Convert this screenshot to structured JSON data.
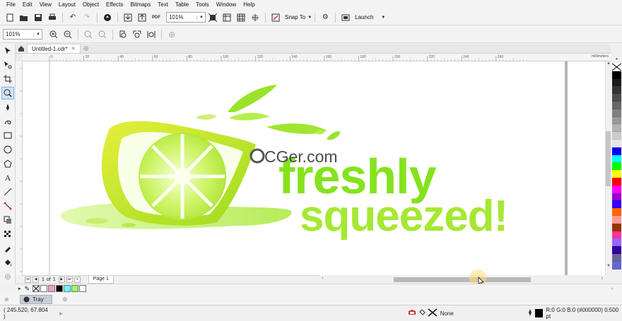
{
  "menu": [
    "File",
    "Edit",
    "View",
    "Layout",
    "Object",
    "Effects",
    "Bitmaps",
    "Text",
    "Table",
    "Tools",
    "Window",
    "Help"
  ],
  "toolbar1": {
    "zoom_value": "101%",
    "snap_label": "Snap To",
    "launch_label": "Launch"
  },
  "toolbar2": {
    "zoom_value": "101%"
  },
  "document": {
    "tab_title": "Untitled-1.cdr*"
  },
  "ruler": {
    "unit_label": "millimeters",
    "h_ticks": [
      "0",
      "20",
      "40",
      "60",
      "80",
      "100",
      "120",
      "140",
      "160",
      "180",
      "200",
      "220",
      "240",
      "260"
    ]
  },
  "artwork": {
    "line1": "freshly",
    "line2": "squeezed!",
    "watermark": "CGer.com",
    "colors": {
      "green": "#86e21d",
      "lime": "#b7f23a",
      "yellow_green": "#d8f04a",
      "pale": "#eaffb5"
    }
  },
  "pagenav": {
    "current": "1",
    "of_label": "of",
    "total": "1",
    "page_tab": "Page 1"
  },
  "palette_colors": [
    "#ffffff",
    "#000000",
    "#1a1a1a",
    "#333333",
    "#4d4d4d",
    "#666666",
    "#808080",
    "#999999",
    "#b3b3b3",
    "#cccccc",
    "#e6e6e6",
    "#0000ff",
    "#00ffff",
    "#00ff00",
    "#ffff00",
    "#ff0000",
    "#ff00ff",
    "#9900cc",
    "#3300ff",
    "#ff6600",
    "#ff9999",
    "#993300",
    "#ff3399",
    "#9966ff",
    "#330099",
    "#666699",
    "#6666cc"
  ],
  "doc_palette_colors": [
    "#ffffff",
    "#ff99cc",
    "#000000",
    "#66ffff",
    "#99ff66",
    "#ffffff"
  ],
  "tray": {
    "label": "Tray"
  },
  "status": {
    "coords": "( 245.520, 67.804 )",
    "fill_label": "None",
    "outline_info": "R:0 G:0 B:0 (#000000)  0.500 pt"
  }
}
